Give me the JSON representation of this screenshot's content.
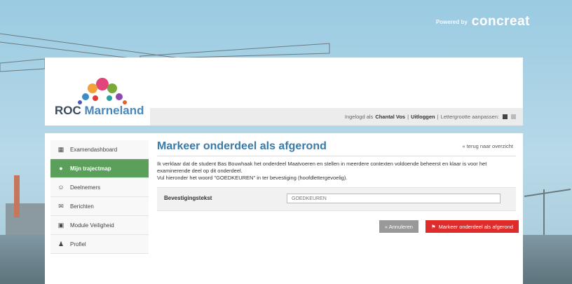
{
  "powered_by": {
    "label": "Powered by",
    "brand": "concreat"
  },
  "logo": {
    "text_a": "ROC",
    "text_b": "Marneland"
  },
  "userbar": {
    "prefix": "Ingelogd als",
    "user": "Chantal Vos",
    "logout": "Uitloggen",
    "fontsize_label": "Lettergrootte aanpassen:"
  },
  "sidebar": {
    "items": [
      {
        "label": "Examendashboard",
        "icon": "dashboard-icon"
      },
      {
        "label": "Mijn trajectmap",
        "icon": "map-icon",
        "active": true
      },
      {
        "label": "Deelnemers",
        "icon": "users-icon"
      },
      {
        "label": "Berichten",
        "icon": "messages-icon"
      },
      {
        "label": "Module Veiligheid",
        "icon": "module-icon"
      },
      {
        "label": "Profiel",
        "icon": "user-icon"
      }
    ]
  },
  "main": {
    "title": "Markeer onderdeel als afgerond",
    "back_link": "« terug naar overzicht",
    "paragraph1": "Ik verklaar dat de student Bas Bouwhaak het onderdeel Maatvoeren en stellen in meerdere contexten voldoende beheerst en klaar is voor het examinerende deel op dit onderdeel.",
    "paragraph2": "Vul hieronder het woord \"GOEDKEUREN\" in ter bevestiging (hoofdlettergevoelig).",
    "field_label": "Bevestigingstekst",
    "field_placeholder": "GOEDKEUREN",
    "cancel_label": "« Annuleren",
    "confirm_label": "Markeer onderdeel als afgerond"
  },
  "colors": {
    "accent": "#3a7aa8",
    "active_nav": "#5aa05a",
    "danger": "#e02b2b"
  }
}
